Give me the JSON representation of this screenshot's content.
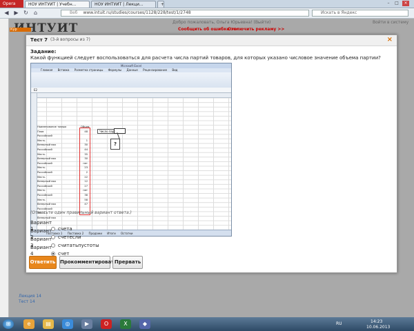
{
  "browser": {
    "menu_label": "Opera",
    "tabs": [
      {
        "label": "НОУ ИНТУИТ | Учебн..."
      },
      {
        "label": "НОУ ИНТУИТ | Лекци..."
      }
    ],
    "url_site": "Веб",
    "url": "www.intuit.ru/studies/courses/1128/228/test/1/2748",
    "search_placeholder": "Искать в Яндекс"
  },
  "site": {
    "logo": "ИНТУИТ",
    "greeting": "Добро пожаловать, Ольга Юрьевна! (Выйти)",
    "errors_link": "Сообщить об ошибке >>",
    "ads_link": "Отключить рекламу >>",
    "right_link": "Войти в систему",
    "left_nav": "Кур",
    "bottom_items": [
      "Лекция 14",
      "Тест 14"
    ]
  },
  "dialog": {
    "title": "Тест 7",
    "subtitle": "(3-й вопросы из 7)",
    "close": "×",
    "task_title": "Задание:",
    "question": "Какой функцией следует воспользоваться для расчета числа партий товаров, для которых указано числовое значение объема партии?",
    "hint": "(Отметьте один правильный вариант ответа.)",
    "options": [
      {
        "label": "Вариант 1",
        "text": "счета",
        "selected": false
      },
      {
        "label": "Вариант 2",
        "text": "счетесли",
        "selected": false
      },
      {
        "label": "Вариант 3",
        "text": "считатьпустоты",
        "selected": false
      },
      {
        "label": "Вариант 4",
        "text": "счет",
        "selected": true
      }
    ],
    "buttons": {
      "submit": "Ответить",
      "comment": "Прокомментировать",
      "abort": "Прервать"
    }
  },
  "excel": {
    "title": "Microsoft Excel",
    "ribbon_tabs": [
      "Главная",
      "Вставка",
      "Разметка страницы",
      "Формулы",
      "Данные",
      "Рецензирование",
      "Вид"
    ],
    "name_box": "E2",
    "header_a": "Наименование товара",
    "header_b": "Объем",
    "rows": [
      {
        "name": "Плов",
        "value": "48"
      },
      {
        "name": "Российский",
        "value": ""
      },
      {
        "name": "Месть",
        "value": "1"
      },
      {
        "name": "Венерный мох",
        "value": "30"
      },
      {
        "name": "Российский",
        "value": "44"
      },
      {
        "name": "Месть",
        "value": "35"
      },
      {
        "name": "Венерный мох",
        "value": "30"
      },
      {
        "name": "Российский",
        "value": "нет"
      },
      {
        "name": "Месть",
        "value": "23"
      },
      {
        "name": "Российский",
        "value": "2"
      },
      {
        "name": "Месть",
        "value": "22"
      },
      {
        "name": "Венерный мох",
        "value": "12"
      },
      {
        "name": "Российский",
        "value": "27"
      },
      {
        "name": "Месть",
        "value": "нет"
      },
      {
        "name": "Российский",
        "value": "38"
      },
      {
        "name": "Месть",
        "value": "58"
      },
      {
        "name": "Венерный мох",
        "value": "47"
      },
      {
        "name": "Российский",
        "value": ""
      },
      {
        "name": "Месть",
        "value": ""
      },
      {
        "name": "Венерный мох",
        "value": ""
      }
    ],
    "count_label": "Число партий",
    "question_mark": "?",
    "sheet_tabs": [
      "Поставка 1",
      "Поставка 2",
      "Продажи",
      "Итоги",
      "Остатки"
    ]
  },
  "taskbar": {
    "lang": "RU",
    "time": "14:23",
    "date": "10.06.2013"
  }
}
